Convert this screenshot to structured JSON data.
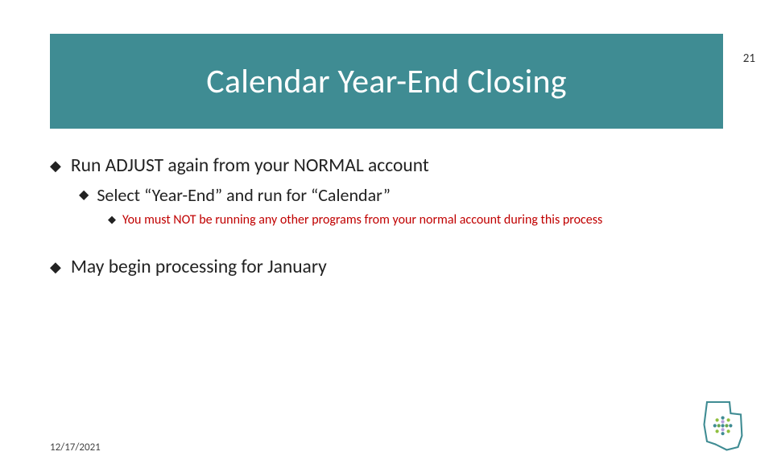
{
  "slide_number": "21",
  "title": "Calendar Year-End Closing",
  "bullets": {
    "b1": "Run ADJUST again from your NORMAL account",
    "b1_1": "Select “Year-End” and run for “Calendar”",
    "b1_1_1": "You must NOT be running any other programs from your normal account during this process",
    "b2": "May begin processing for January"
  },
  "footer_date": "12/17/2021",
  "colors": {
    "title_band": "#3f8c93",
    "warning_text": "#c00000"
  }
}
